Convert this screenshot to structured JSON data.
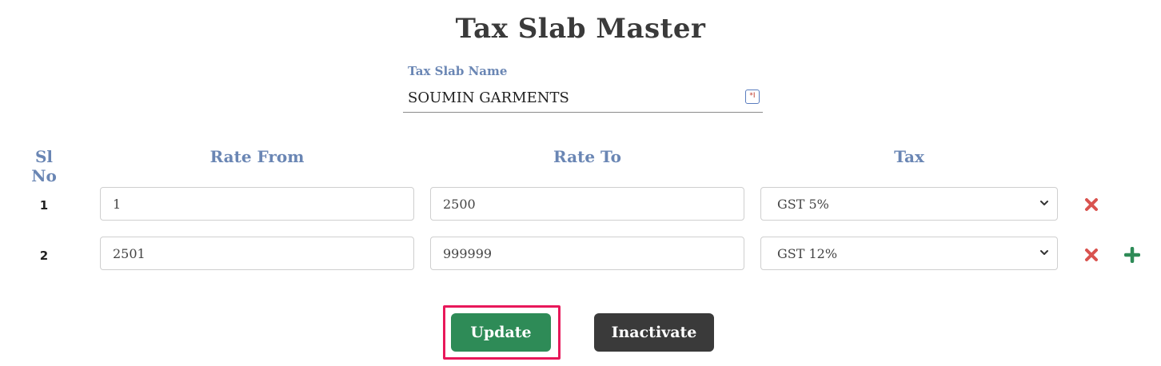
{
  "page": {
    "title": "Tax Slab Master"
  },
  "tax_slab_name": {
    "label": "Tax Slab Name",
    "value": "SOUMIN GARMENTS",
    "icon": "keyboard-icon"
  },
  "table": {
    "headers": {
      "sl_no": "Sl No",
      "rate_from": "Rate From",
      "rate_to": "Rate To",
      "tax": "Tax"
    },
    "rows": [
      {
        "sl_no": "1",
        "rate_from": "1",
        "rate_to": "2500",
        "tax": "GST 5%"
      },
      {
        "sl_no": "2",
        "rate_from": "2501",
        "rate_to": "999999",
        "tax": "GST 12%"
      }
    ]
  },
  "actions": {
    "update_label": "Update",
    "inactivate_label": "Inactivate"
  },
  "colors": {
    "header_blue": "#6a86b4",
    "update_green": "#2e8b57",
    "inactivate_dark": "#3a3a3a",
    "delete_red": "#d9534f",
    "add_green": "#2e8b57",
    "highlight": "#e8185a"
  }
}
